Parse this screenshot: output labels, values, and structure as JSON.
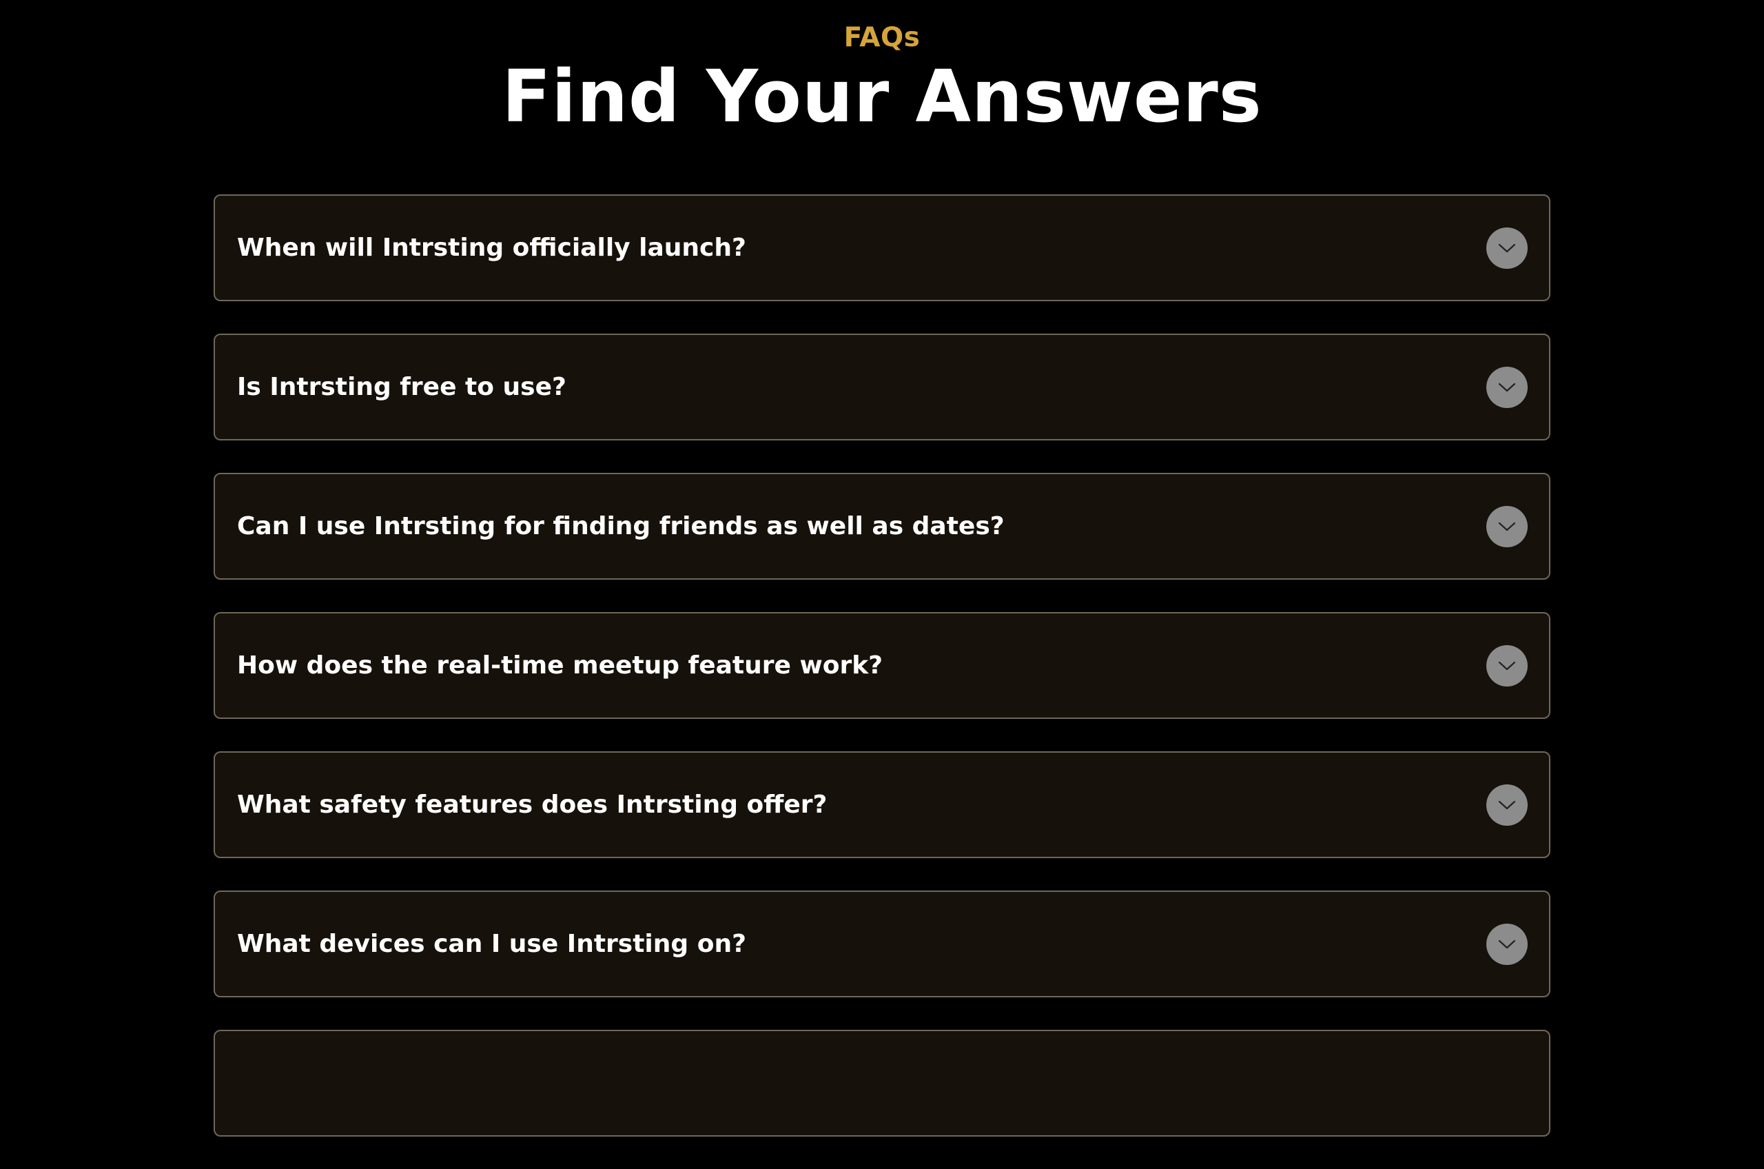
{
  "header": {
    "eyebrow": "FAQs",
    "title": "Find Your Answers"
  },
  "faqs": [
    {
      "question": "When will Intrsting officially launch?"
    },
    {
      "question": "Is Intrsting free to use?"
    },
    {
      "question": "Can I use Intrsting for finding friends as well as dates?"
    },
    {
      "question": "How does the real-time meetup feature work?"
    },
    {
      "question": "What safety features does Intrsting offer?"
    },
    {
      "question": "What devices can I use Intrsting on?"
    },
    {
      "question": ""
    }
  ],
  "icons": {
    "toggle": "chevron-down-icon"
  },
  "colors": {
    "background": "#000000",
    "accent": "#d6a43a",
    "card_background": "#16110a",
    "card_border": "#6f6759",
    "toggle_circle": "#8c8c8c"
  }
}
